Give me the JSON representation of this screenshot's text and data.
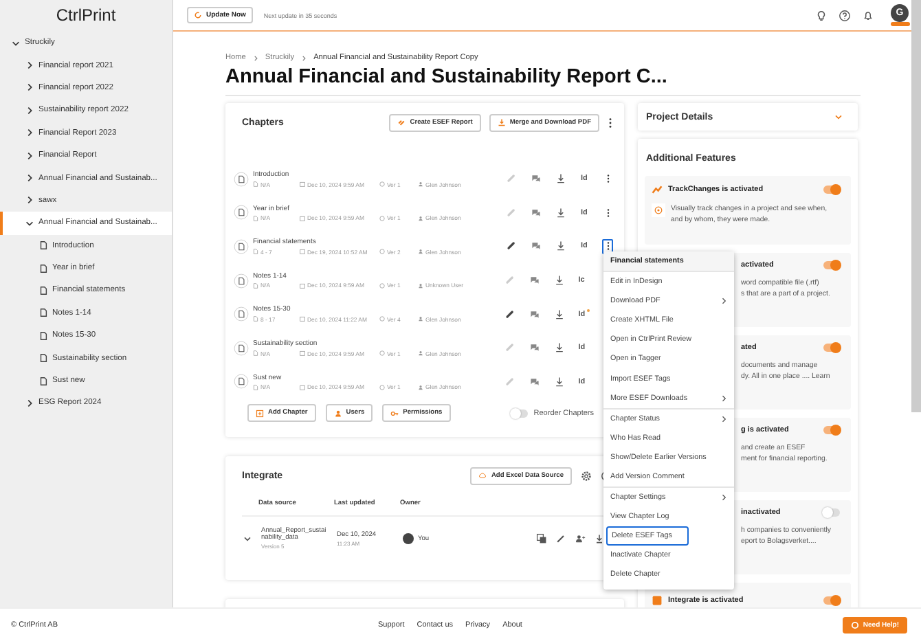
{
  "topbar": {
    "update_button": "Update Now",
    "next_update": "Next update in 35 seconds",
    "avatar": "G"
  },
  "sidebar": {
    "logo": "CtrlPrint",
    "tree": [
      {
        "label": "Struckily",
        "kind": "folder",
        "expanded": true,
        "selected": false,
        "children": [
          {
            "label": "Financial report 2021",
            "kind": "folder",
            "expanded": false,
            "selected": false
          },
          {
            "label": "Financial report 2022",
            "kind": "folder",
            "expanded": false,
            "selected": false
          },
          {
            "label": "Sustainability report 2022",
            "kind": "folder",
            "expanded": false,
            "selected": false
          },
          {
            "label": "Financial Report 2023",
            "kind": "folder",
            "expanded": false,
            "selected": false
          },
          {
            "label": "Financial Report",
            "kind": "folder",
            "expanded": false,
            "selected": false
          },
          {
            "label": "Annual Financial and Sustainab...",
            "kind": "folder",
            "expanded": false,
            "selected": false
          },
          {
            "label": "sawx",
            "kind": "folder",
            "expanded": false,
            "selected": false
          },
          {
            "label": "Annual Financial and Sustainab...",
            "kind": "folder",
            "expanded": true,
            "selected": true,
            "children": [
              {
                "label": "Introduction",
                "kind": "document",
                "selected": false
              },
              {
                "label": "Year in brief",
                "kind": "document",
                "selected": false
              },
              {
                "label": "Financial statements",
                "kind": "document",
                "selected": false
              },
              {
                "label": "Notes 1-14",
                "kind": "document",
                "selected": false
              },
              {
                "label": "Notes 15-30",
                "kind": "document",
                "selected": false
              },
              {
                "label": "Sustainability section",
                "kind": "document",
                "selected": false
              },
              {
                "label": "Sust new",
                "kind": "document",
                "selected": false
              }
            ]
          },
          {
            "label": "ESG Report 2024",
            "kind": "folder",
            "expanded": false,
            "selected": false
          }
        ]
      }
    ]
  },
  "breadcrumb": [
    "Home",
    "Struckily",
    "Annual Financial and Sustainability Report Copy"
  ],
  "title": "Annual Financial and Sustainability Report C...",
  "chapters": {
    "title": "Chapters",
    "actions": [
      "Create ESEF Report",
      "Merge and Download PDF"
    ],
    "rows": [
      {
        "name": "Introduction",
        "pages": "N/A",
        "date": "Dec 10, 2024 9:59 AM",
        "version": "Ver 1",
        "user": "Glen Johnson",
        "linked": false,
        "tool": "Id",
        "notified": false,
        "selected": false
      },
      {
        "name": "Year in brief",
        "pages": "N/A",
        "date": "Dec 10, 2024 9:59 AM",
        "version": "Ver 1",
        "user": "Glen Johnson",
        "linked": false,
        "tool": "Id",
        "notified": false,
        "selected": false
      },
      {
        "name": "Financial statements",
        "pages": "4 - 7",
        "date": "Dec 19, 2024 10:52 AM",
        "version": "Ver 2",
        "user": "Glen Johnson",
        "linked": true,
        "tool": "Id",
        "notified": false,
        "selected": true
      },
      {
        "name": "Notes 1-14",
        "pages": "N/A",
        "date": "Dec 10, 2024 9:59 AM",
        "version": "Ver 1",
        "user": "Unknown User",
        "linked": false,
        "tool": "Ic",
        "notified": false
      },
      {
        "name": "Notes 15-30",
        "pages": "8 - 17",
        "date": "Dec 10, 2024 11:22 AM",
        "version": "Ver 4",
        "user": "Glen Johnson",
        "linked": true,
        "tool": "Id",
        "notified": true
      },
      {
        "name": "Sustainability section",
        "pages": "N/A",
        "date": "Dec 10, 2024 9:59 AM",
        "version": "Ver 1",
        "user": "Glen Johnson",
        "linked": false,
        "tool": "Id",
        "notified": false
      },
      {
        "name": "Sust new",
        "pages": "N/A",
        "date": "Dec 10, 2024 9:59 AM",
        "version": "Ver 1",
        "user": "Glen Johnson",
        "linked": false,
        "tool": "Id",
        "notified": false
      }
    ],
    "footer_buttons": [
      "Add Chapter",
      "Users",
      "Permissions"
    ],
    "reorder": {
      "label": "Reorder Chapters",
      "on": false
    }
  },
  "integrate": {
    "title": "Integrate",
    "add_button": "Add Excel Data Source",
    "columns": [
      "Data source",
      "Last updated",
      "Owner"
    ],
    "rows": [
      {
        "source": "Annual_Report_sustainability_data",
        "version": "Version 5",
        "date": "Dec 10, 2024",
        "time": "11:23 AM",
        "owner": "You"
      }
    ]
  },
  "project_details": {
    "title": "Project Details"
  },
  "additional": {
    "title": "Additional Features",
    "features": [
      {
        "kind": "full",
        "title": "TrackChanges is activated",
        "description": "Visually track changes in a project and see when, and by whom, they were made.",
        "on": true
      },
      {
        "kind": "clipped",
        "title": "activated",
        "description": [
          "word compatible file (.rtf)",
          "s that are a part of a project."
        ],
        "on": true
      },
      {
        "kind": "clipped",
        "title": "ated",
        "description": [
          "documents and manage",
          "dy. All in one place .... Learn"
        ],
        "on": true
      },
      {
        "kind": "clipped",
        "title": "g is activated",
        "description": [
          "and create an ESEF",
          "ment for financial reporting."
        ],
        "on": true
      },
      {
        "kind": "clipped",
        "title": "inactivated",
        "description": [
          "h companies to conveniently",
          "eport to Bolagsverket...."
        ],
        "on": false
      },
      {
        "kind": "integrate",
        "title": "Integrate is activated",
        "on": true
      }
    ]
  },
  "menu": {
    "header": "Financial statements",
    "groups": [
      [
        {
          "label": "Edit in InDesign",
          "submenu": false,
          "selected": false
        },
        {
          "label": "Download PDF",
          "submenu": true,
          "selected": false
        },
        {
          "label": "Create XHTML File",
          "submenu": false,
          "selected": false
        },
        {
          "label": "Open in CtrlPrint Review",
          "submenu": false,
          "selected": false
        },
        {
          "label": "Open in Tagger",
          "submenu": false,
          "selected": false
        },
        {
          "label": "Import ESEF Tags",
          "submenu": false,
          "selected": false
        },
        {
          "label": "More ESEF Downloads",
          "submenu": true,
          "selected": false
        }
      ],
      [
        {
          "label": "Chapter Status",
          "submenu": true,
          "selected": false
        },
        {
          "label": "Who Has Read",
          "submenu": false,
          "selected": false
        },
        {
          "label": "Show/Delete Earlier Versions",
          "submenu": false,
          "selected": false
        },
        {
          "label": "Add Version Comment",
          "submenu": false,
          "selected": false
        }
      ],
      [
        {
          "label": "Chapter Settings",
          "submenu": true,
          "selected": false
        },
        {
          "label": "View Chapter Log",
          "submenu": false,
          "selected": false
        },
        {
          "label": "Delete ESEF Tags",
          "submenu": false,
          "selected": true
        },
        {
          "label": "Inactivate Chapter",
          "submenu": false,
          "selected": false
        },
        {
          "label": "Delete Chapter",
          "submenu": false,
          "selected": false
        }
      ]
    ]
  },
  "footer": {
    "copyright": "© CtrlPrint AB",
    "links": [
      "Support",
      "Contact us",
      "Privacy",
      "About"
    ],
    "help_button": "Need Help!"
  }
}
